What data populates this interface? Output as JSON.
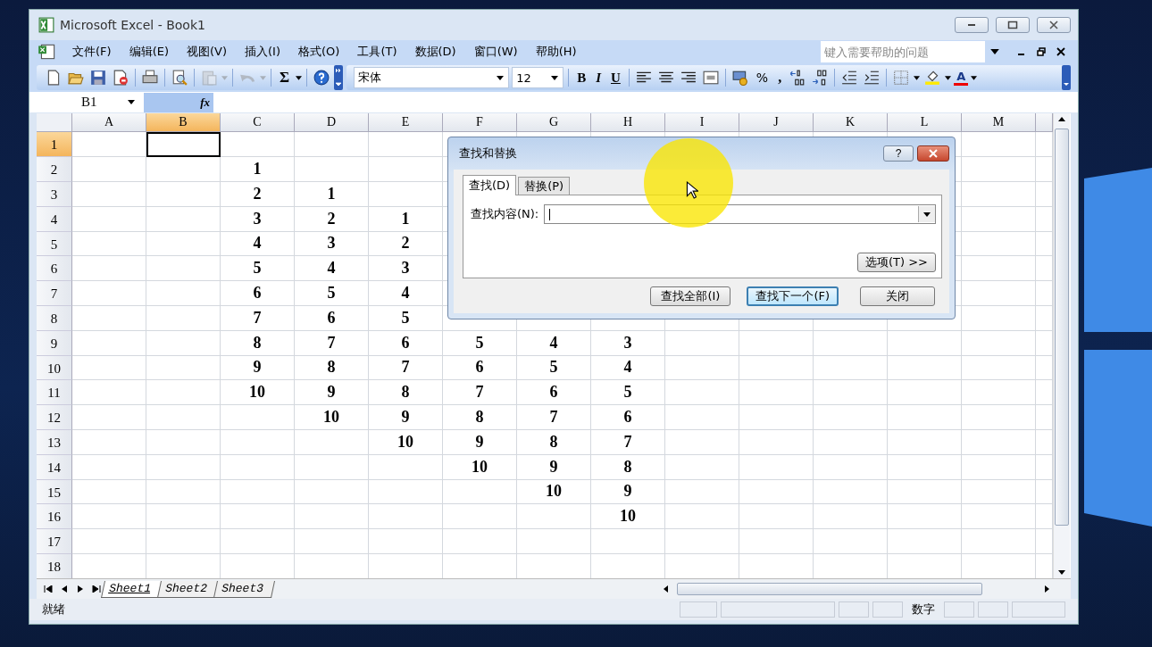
{
  "window": {
    "title": "Microsoft Excel - Book1"
  },
  "menu": [
    {
      "label": "文件(F)"
    },
    {
      "label": "编辑(E)"
    },
    {
      "label": "视图(V)"
    },
    {
      "label": "插入(I)"
    },
    {
      "label": "格式(O)"
    },
    {
      "label": "工具(T)"
    },
    {
      "label": "数据(D)"
    },
    {
      "label": "窗口(W)"
    },
    {
      "label": "帮助(H)"
    }
  ],
  "help_search": {
    "placeholder": "键入需要帮助的问题"
  },
  "standard_toolbar": {
    "sum": "Σ"
  },
  "format_toolbar": {
    "font": "宋体",
    "size": "12",
    "bold": "B",
    "italic": "I",
    "underline": "U",
    "percent": "%",
    "comma": ",",
    "font_color": "A"
  },
  "formula_bar": {
    "name_box": "B1",
    "fx": "fx"
  },
  "columns": [
    {
      "label": "A",
      "selected": false
    },
    {
      "label": "B",
      "selected": true
    },
    {
      "label": "C",
      "selected": false
    },
    {
      "label": "D",
      "selected": false
    },
    {
      "label": "E",
      "selected": false
    },
    {
      "label": "F",
      "selected": false
    },
    {
      "label": "G",
      "selected": false
    },
    {
      "label": "H",
      "selected": false
    },
    {
      "label": "I",
      "selected": false
    },
    {
      "label": "J",
      "selected": false
    },
    {
      "label": "K",
      "selected": false
    },
    {
      "label": "L",
      "selected": false
    },
    {
      "label": "M",
      "selected": false
    }
  ],
  "rows": [
    {
      "label": "1",
      "selected": true,
      "cells": []
    },
    {
      "label": "2",
      "selected": false,
      "cells": [
        null,
        null,
        "1"
      ]
    },
    {
      "label": "3",
      "selected": false,
      "cells": [
        null,
        null,
        "2",
        "1"
      ]
    },
    {
      "label": "4",
      "selected": false,
      "cells": [
        null,
        null,
        "3",
        "2",
        "1"
      ]
    },
    {
      "label": "5",
      "selected": false,
      "cells": [
        null,
        null,
        "4",
        "3",
        "2"
      ]
    },
    {
      "label": "6",
      "selected": false,
      "cells": [
        null,
        null,
        "5",
        "4",
        "3"
      ]
    },
    {
      "label": "7",
      "selected": false,
      "cells": [
        null,
        null,
        "6",
        "5",
        "4"
      ]
    },
    {
      "label": "8",
      "selected": false,
      "cells": [
        null,
        null,
        "7",
        "6",
        "5"
      ]
    },
    {
      "label": "9",
      "selected": false,
      "cells": [
        null,
        null,
        "8",
        "7",
        "6",
        "5",
        "4",
        "3"
      ]
    },
    {
      "label": "10",
      "selected": false,
      "cells": [
        null,
        null,
        "9",
        "8",
        "7",
        "6",
        "5",
        "4"
      ]
    },
    {
      "label": "11",
      "selected": false,
      "cells": [
        null,
        null,
        "10",
        "9",
        "8",
        "7",
        "6",
        "5"
      ]
    },
    {
      "label": "12",
      "selected": false,
      "cells": [
        null,
        null,
        null,
        "10",
        "9",
        "8",
        "7",
        "6"
      ]
    },
    {
      "label": "13",
      "selected": false,
      "cells": [
        null,
        null,
        null,
        null,
        "10",
        "9",
        "8",
        "7"
      ]
    },
    {
      "label": "14",
      "selected": false,
      "cells": [
        null,
        null,
        null,
        null,
        null,
        "10",
        "9",
        "8"
      ]
    },
    {
      "label": "15",
      "selected": false,
      "cells": [
        null,
        null,
        null,
        null,
        null,
        null,
        "10",
        "9"
      ]
    },
    {
      "label": "16",
      "selected": false,
      "cells": [
        null,
        null,
        null,
        null,
        null,
        null,
        null,
        "10"
      ]
    },
    {
      "label": "17",
      "selected": false,
      "cells": []
    },
    {
      "label": "18",
      "selected": false,
      "cells": []
    }
  ],
  "dialog": {
    "title": "查找和替换",
    "help": "?",
    "tabs": [
      {
        "label": "查找(D)",
        "selected": true
      },
      {
        "label": "替换(P)",
        "selected": false
      }
    ],
    "find_label": "查找内容(N):",
    "options_button": "选项(T) >>",
    "buttons": [
      {
        "label": "查找全部(I)",
        "default": false
      },
      {
        "label": "查找下一个(F)",
        "default": true
      },
      {
        "label": "关闭",
        "default": false
      }
    ]
  },
  "sheet_tabs": [
    {
      "label": "Sheet1",
      "selected": true
    },
    {
      "label": "Sheet2",
      "selected": false
    },
    {
      "label": "Sheet3",
      "selected": false
    }
  ],
  "status_bar": {
    "status": "就绪",
    "mode": "数字"
  }
}
